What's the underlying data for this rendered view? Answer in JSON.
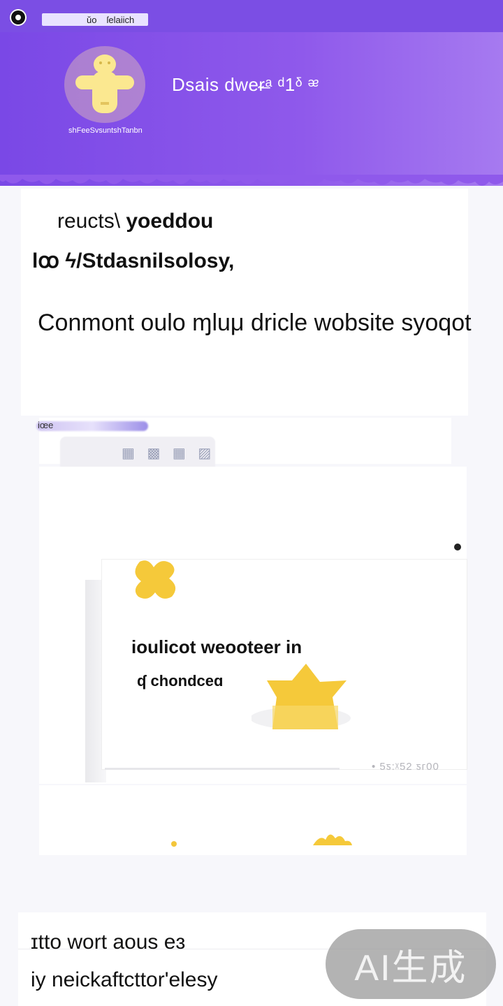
{
  "topbar": {
    "tab_1": "ŭo",
    "tab_2": "ſelaiich"
  },
  "hero": {
    "title": "Dsais dwe⁠ᵲ̶ᵃ ᵈ1ᵟ ᵆ",
    "mascot_caption": "shFeeSvsuntshTanbn"
  },
  "card1": {
    "line_1_regular": "reucts\\ ",
    "line_1_bold": "yoeddou",
    "line_2": "lꝏ ϟ/Stdasnilsolosy,",
    "line_3": "Conmont oulo ɱluμ dricle wobsite syoqot"
  },
  "mid": {
    "tag_label": "iœe",
    "panel_icons": "▦ ▩ ▦ ▨"
  },
  "card3": {
    "text_1": "ioulicot weooteer in",
    "text_2": "ʠ chondceɑ",
    "meta": "• 5ƽ:ᵡ52 ƽᴦ00"
  },
  "card5": {
    "line_1": "ɪtto wort aous eɜ",
    "line_2": "iy neickaftcttor'elesy"
  },
  "badge": {
    "label": "AI生成"
  },
  "colors": {
    "header_purple": "#7b4ee4",
    "accent_yellow": "#f5c93a",
    "badge_gray": "#969696"
  }
}
